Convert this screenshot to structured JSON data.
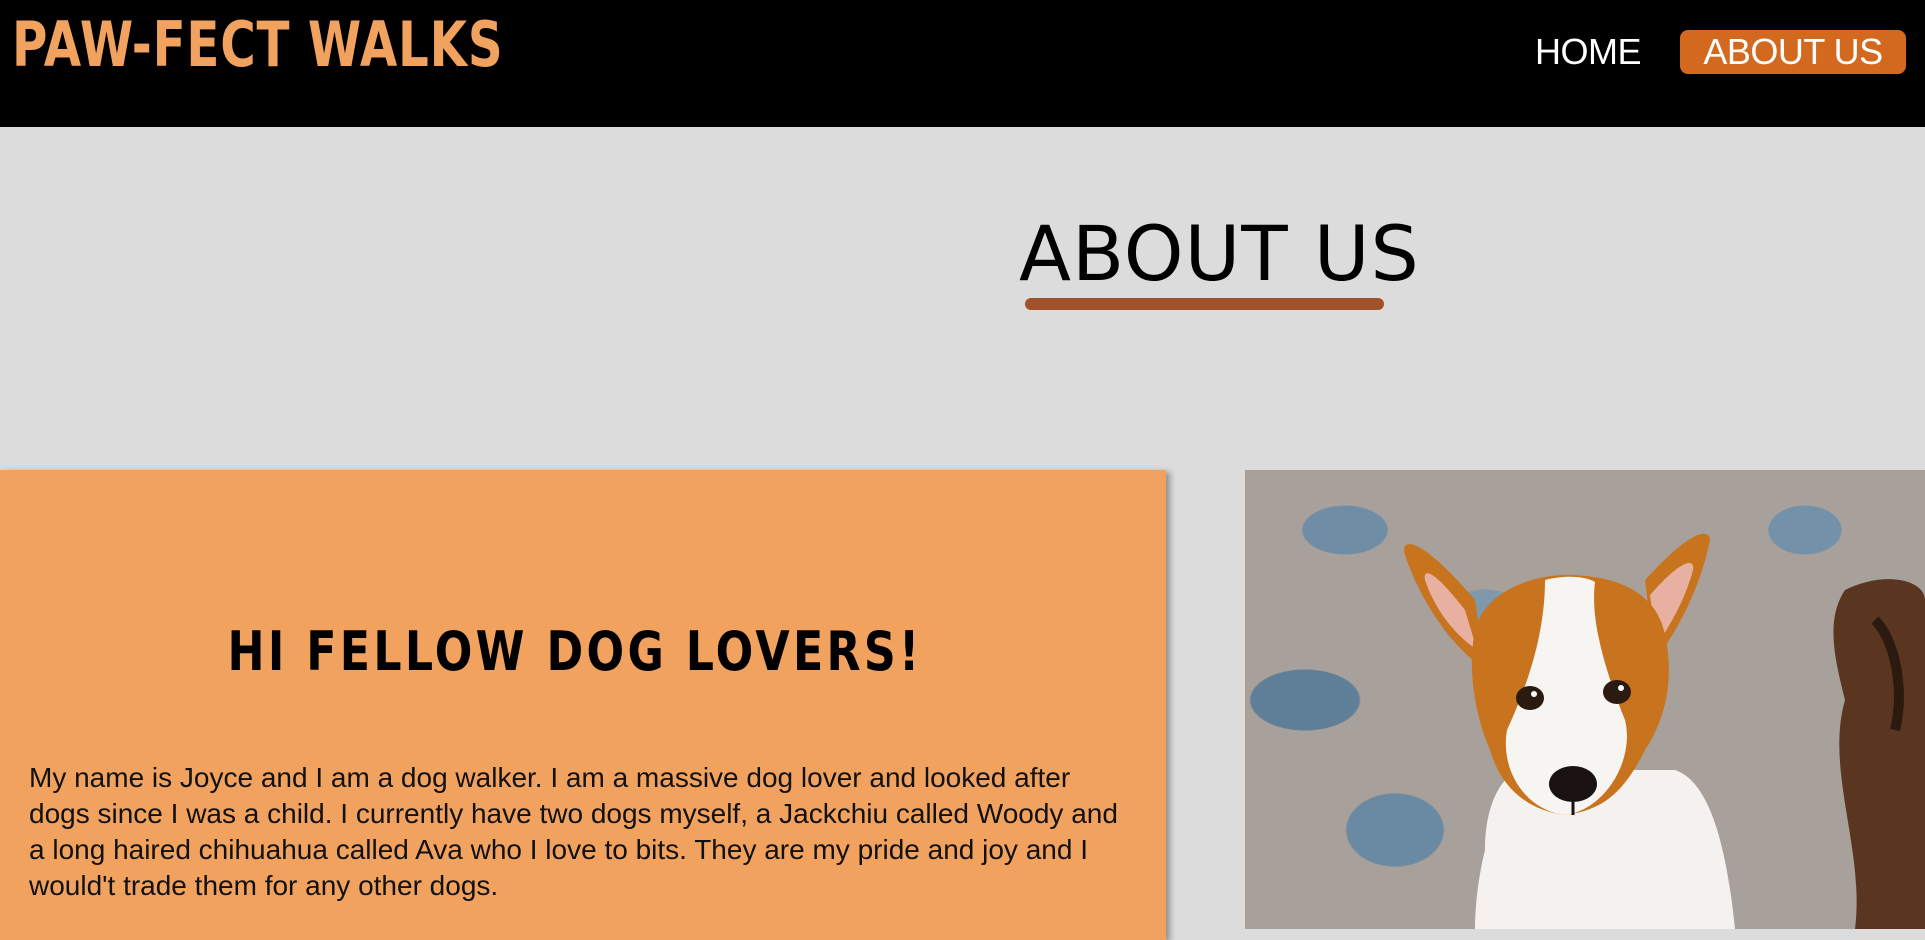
{
  "header": {
    "brand": "PAW-FECT WALKS",
    "nav": [
      {
        "label": "HOME"
      },
      {
        "label": "ABOUT US",
        "active": true
      }
    ]
  },
  "main": {
    "title": "ABOUT US",
    "intro": {
      "heading": "HI FELLOW DOG LOVERS!",
      "text": "My name is Joyce and I am a dog walker. I am a massive dog lover and looked after dogs since I was a child. I currently have two dogs myself, a Jackchiu called Woody and a long haired chihuahua called Ava who I love to bits. They are my pride and joy and I would't trade them for any other dogs."
    },
    "photo": {
      "subject": "jack russell terrier dog"
    }
  },
  "colors": {
    "header_bg": "#000000",
    "brand": "#f2a25f",
    "active_nav_bg": "#d3691f",
    "underline": "#a0522d",
    "card_bg": "#f2a25f",
    "page_bg": "#dcdcdc"
  }
}
